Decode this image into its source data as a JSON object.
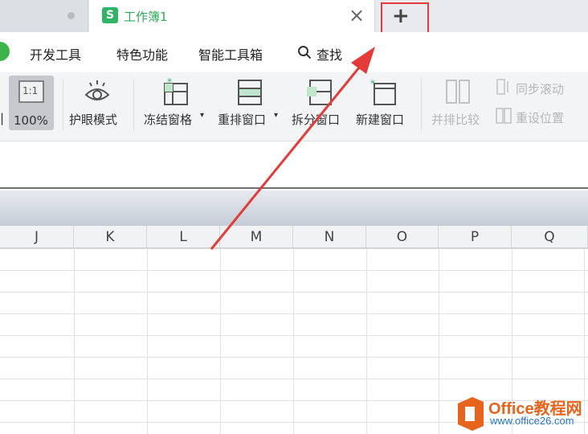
{
  "tabs": {
    "active_title": "工作簿1",
    "app_icon_letter": "S",
    "close_glyph": "×",
    "new_tab_glyph": "+"
  },
  "menu": {
    "items": [
      "开发工具",
      "特色功能",
      "智能工具箱",
      "查找"
    ]
  },
  "ribbon": {
    "cut_label": "|",
    "zoom_100": "100%",
    "zoom_icon_text": "1:1",
    "eye_mode": "护眼模式",
    "freeze": "冻结窗格",
    "rearrange": "重排窗口",
    "split": "拆分窗口",
    "new_window": "新建窗口",
    "side_by_side": "并排比较",
    "sync_scroll": "同步滚动",
    "reset_position": "重设位置",
    "dropdown_glyph": "▾"
  },
  "columns": [
    "J",
    "K",
    "L",
    "M",
    "N",
    "O",
    "P",
    "Q"
  ],
  "watermark": {
    "brand": "Office教程网",
    "url": "www.office26.com"
  },
  "colors": {
    "accent_green": "#2fb565",
    "highlight_red": "#e43a3a",
    "brand_orange": "#e8641d"
  }
}
